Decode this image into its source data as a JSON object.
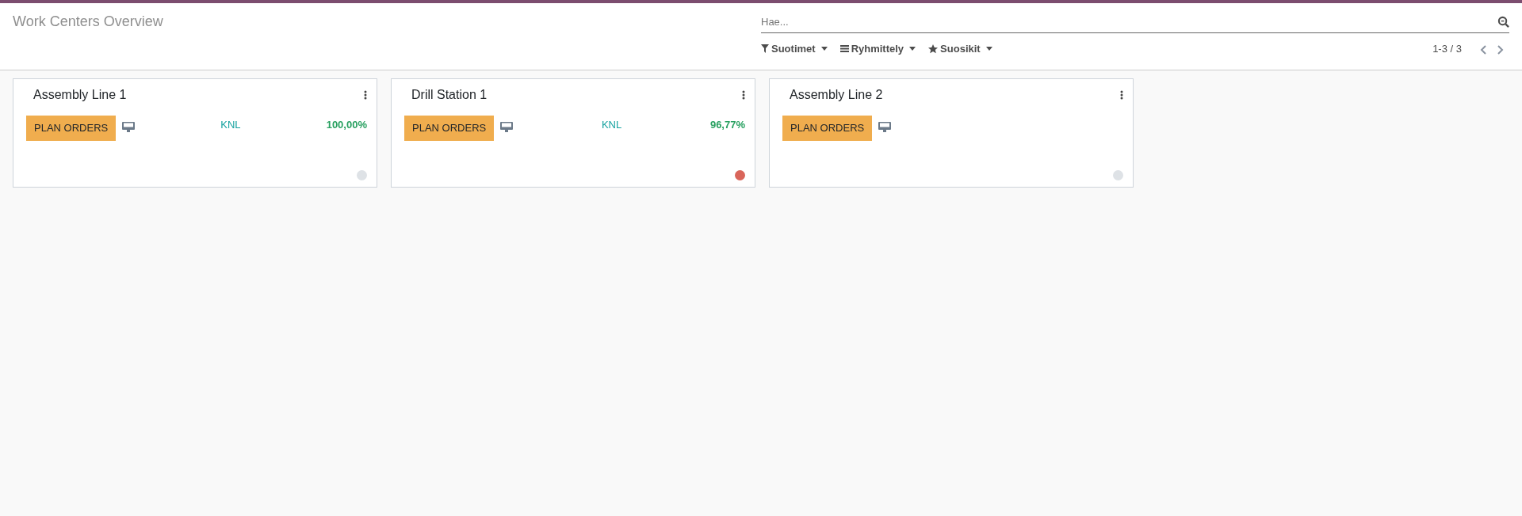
{
  "breadcrumb": {
    "title": "Work Centers Overview"
  },
  "search": {
    "placeholder": "Hae..."
  },
  "filters": [
    {
      "label": "Suotimet",
      "kind": "filter"
    },
    {
      "label": "Ryhmittely",
      "kind": "group"
    },
    {
      "label": "Suosikit",
      "kind": "favorite"
    }
  ],
  "pager": {
    "value": "1-3 / 3"
  },
  "cards": [
    {
      "name": "Assembly Line 1",
      "button": "PLAN ORDERS",
      "code": "KNL",
      "efficiency": "100,00%",
      "color": "#dee2e6"
    },
    {
      "name": "Drill Station 1",
      "button": "PLAN ORDERS",
      "code": "KNL",
      "efficiency": "96,77%",
      "color": "#d9655a"
    },
    {
      "name": "Assembly Line 2",
      "button": "PLAN ORDERS",
      "color": "#dee2e6"
    }
  ]
}
